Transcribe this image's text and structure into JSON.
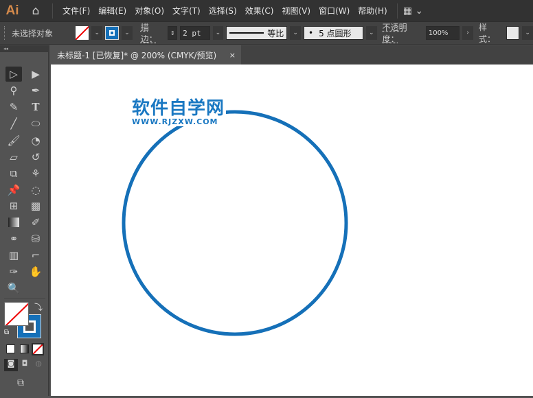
{
  "app": {
    "logo": "Ai"
  },
  "menu": [
    "文件(F)",
    "编辑(E)",
    "对象(O)",
    "文字(T)",
    "选择(S)",
    "效果(C)",
    "视图(V)",
    "窗口(W)",
    "帮助(H)"
  ],
  "control": {
    "selection": "未选择对象",
    "stroke_label": "描边：",
    "stroke_weight": "2 pt",
    "profile": "等比",
    "brush": "5 点圆形",
    "opacity_label": "不透明度：",
    "opacity": "100%",
    "style_label": "样式："
  },
  "document": {
    "tab_title": "未标题-1 [已恢复]* @ 200% (CMYK/预览)",
    "close": "×"
  },
  "canvas": {
    "watermark_title": "软件自学网",
    "watermark_url": "WWW.RJZXW.COM",
    "circle_stroke": "#1570b8"
  },
  "colors": {
    "fill": "none",
    "stroke": "#1570b8"
  }
}
